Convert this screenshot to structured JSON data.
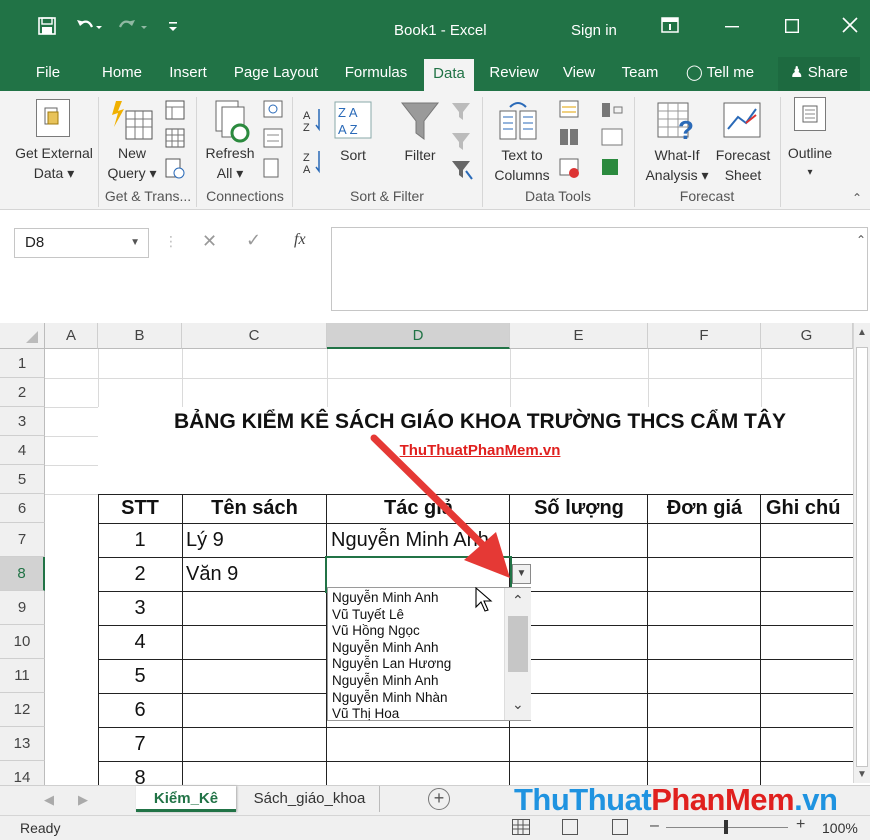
{
  "window": {
    "title": "Book1  -  Excel",
    "sign_in": "Sign in",
    "quick_access": {
      "save_icon": "save-icon",
      "undo_icon": "undo-icon",
      "redo_icon": "redo-icon"
    }
  },
  "tabs": [
    {
      "label": "File"
    },
    {
      "label": "Home"
    },
    {
      "label": "Insert"
    },
    {
      "label": "Page Layout"
    },
    {
      "label": "Formulas"
    },
    {
      "label": "Data",
      "active": true
    },
    {
      "label": "Review"
    },
    {
      "label": "View"
    },
    {
      "label": "Team"
    },
    {
      "label": "Tell me"
    },
    {
      "label": "Share"
    }
  ],
  "ribbon": {
    "get_external_data": [
      "Get External",
      "Data ▾"
    ],
    "new_query": [
      "New",
      "Query ▾"
    ],
    "refresh_all": [
      "Refresh",
      "All ▾"
    ],
    "sort": "Sort",
    "filter": "Filter",
    "text_to_columns": [
      "Text to",
      "Columns"
    ],
    "what_if": [
      "What-If",
      "Analysis ▾"
    ],
    "forecast_sheet": [
      "Forecast",
      "Sheet"
    ],
    "outline": "Outline",
    "groups": [
      "Get & Trans...",
      "Connections",
      "Sort & Filter",
      "Data Tools",
      "Forecast"
    ]
  },
  "formula_bar": {
    "name_box": "D8",
    "fx": "fx",
    "content": ""
  },
  "grid": {
    "columns": [
      "A",
      "B",
      "C",
      "D",
      "E",
      "F",
      "G"
    ],
    "rows": [
      "1",
      "2",
      "3",
      "4",
      "5",
      "6",
      "7",
      "8",
      "9",
      "10",
      "11",
      "12",
      "13",
      "14"
    ],
    "title": "BẢNG KIỂM KÊ SÁCH GIÁO KHOA TRƯỜNG THCS CẨM TÂY",
    "subtitle": "ThuThuatPhanMem.vn",
    "headers": [
      "STT",
      "Tên sách",
      "Tác giả",
      "Số lượng",
      "Đơn giá",
      "Ghi chú"
    ],
    "stt": [
      "1",
      "2",
      "3",
      "4",
      "5",
      "6",
      "7",
      "8"
    ],
    "ten_sach": [
      "Lý 9",
      "Văn 9"
    ],
    "tac_gia": [
      "Nguyễn Minh Anh"
    ]
  },
  "dropdown": {
    "options": [
      "Nguyễn Minh Anh",
      "Vũ Tuyết Lê",
      "Vũ Hồng Ngọc",
      "Nguyễn Minh Anh",
      "Nguyễn Lan Hương",
      "Nguyễn Minh Anh",
      "Nguyễn Minh Nhàn",
      "Vũ Thị Hoa"
    ]
  },
  "sheets": [
    {
      "label": "Kiểm_Kê",
      "active": true
    },
    {
      "label": "Sách_giáo_khoa",
      "active": false
    }
  ],
  "watermark": {
    "part1": "ThuThuat",
    "part2": "PhanMem",
    "part3": ".vn"
  },
  "status": {
    "text": "Ready",
    "zoom": "100%"
  },
  "colors": {
    "excel_green": "#217346",
    "arrow_red": "#e53935",
    "link_red": "#e0201e"
  }
}
